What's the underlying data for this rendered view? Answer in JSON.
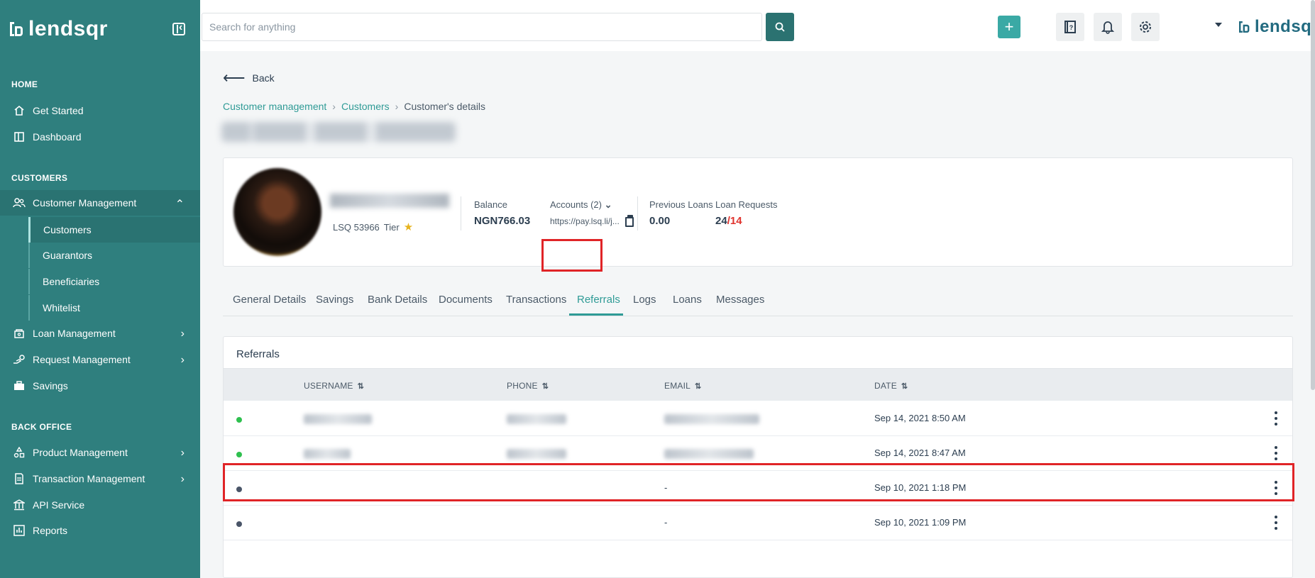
{
  "brand": {
    "logo_text": "lendsqr"
  },
  "header": {
    "search_placeholder": "Search for anything",
    "icons": [
      "search-icon",
      "plus-icon",
      "help-book-icon",
      "bell-icon",
      "gear-icon",
      "caret-down-icon"
    ]
  },
  "sidebar": {
    "sections": {
      "home": "HOME",
      "customers": "CUSTOMERS",
      "back_office": "BACK OFFICE"
    },
    "items": {
      "get_started": "Get Started",
      "dashboard": "Dashboard",
      "customer_management": "Customer Management",
      "customers": "Customers",
      "guarantors": "Guarantors",
      "beneficiaries": "Beneficiaries",
      "whitelist": "Whitelist",
      "loan_management": "Loan Management",
      "request_management": "Request Management",
      "savings": "Savings",
      "product_management": "Product Management",
      "transaction_management": "Transaction Management",
      "api_service": "API Service",
      "reports": "Reports"
    }
  },
  "page": {
    "back_label": "Back",
    "breadcrumb": [
      "Customer management",
      "Customers",
      "Customer's details"
    ]
  },
  "customer": {
    "id_label": "LSQ 53966",
    "tier_label": "Tier",
    "balance_label": "Balance",
    "balance_value": "NGN766.03",
    "accounts_label": "Accounts (2)",
    "account_link": "https://pay.lsq.li/j...",
    "previous_loans_label": "Previous Loans",
    "previous_loans_value": "0.00",
    "loan_requests_label": "Loan Requests",
    "loan_requests_done": "24",
    "loan_requests_sep": "/",
    "loan_requests_total": "14"
  },
  "tabs": [
    "General Details",
    "Savings",
    "Bank Details",
    "Documents",
    "Transactions",
    "Referrals",
    "Logs",
    "Loans",
    "Messages"
  ],
  "active_tab": "Referrals",
  "referrals": {
    "title": "Referrals",
    "columns": [
      "USERNAME",
      "PHONE",
      "EMAIL",
      "DATE"
    ],
    "rows": [
      {
        "status_color": "#2fc04f",
        "email": "",
        "date": "Sep 14, 2021 8:50 AM"
      },
      {
        "status_color": "#2fc04f",
        "email": "",
        "date": "Sep 14, 2021 8:47 AM"
      },
      {
        "status_color": "#4a5568",
        "email": "-",
        "date": "Sep 10, 2021 1:18 PM"
      },
      {
        "status_color": "#4a5568",
        "email": "-",
        "date": "Sep 10, 2021 1:09 PM"
      }
    ]
  },
  "colors": {
    "sidebar": "#2f7f7e",
    "accent": "#2f9b96",
    "highlight": "#e02427"
  }
}
